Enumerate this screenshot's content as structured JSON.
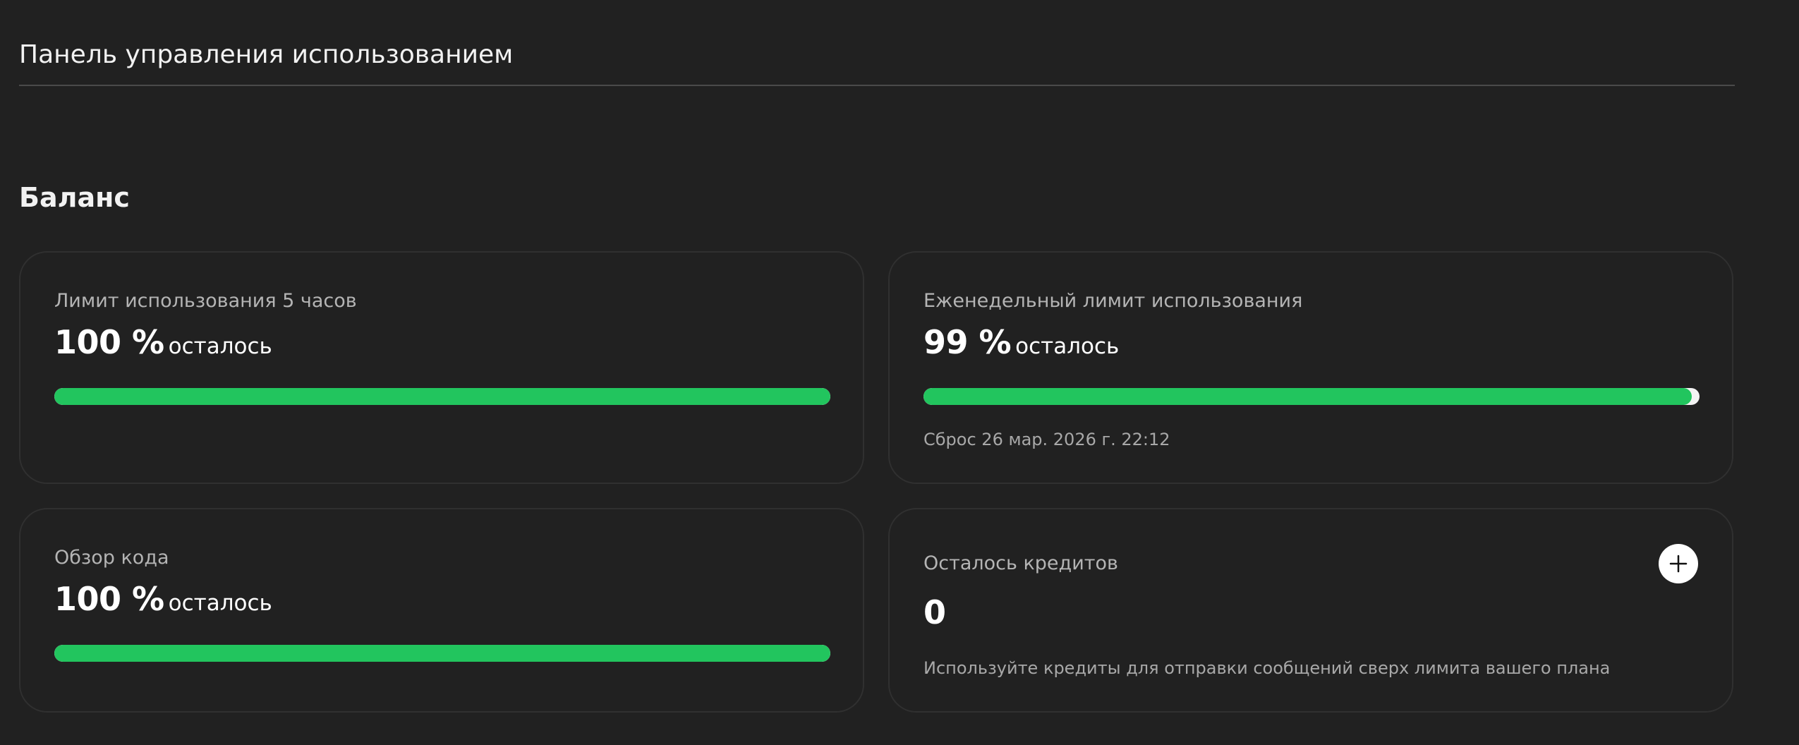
{
  "header": {
    "title": "Панель управления использованием"
  },
  "balance": {
    "title": "Баланс",
    "cards": {
      "five_hour": {
        "label": "Лимит использования 5 часов",
        "value": "100 %",
        "suffix": "осталось",
        "percent_remaining": 100
      },
      "weekly": {
        "label": "Еженедельный лимит использования",
        "value": "99 %",
        "suffix": "осталось",
        "percent_remaining": 99,
        "reset_note": "Сброс 26 мар. 2026 г. 22:12"
      },
      "code_review": {
        "label": "Обзор кода",
        "value": "100 %",
        "suffix": "осталось",
        "percent_remaining": 100
      },
      "credits": {
        "label": "Осталось кредитов",
        "value": "0",
        "note": "Используйте кредиты для отправки сообщений сверх лимита вашего плана",
        "add_icon": "plus-icon"
      }
    }
  },
  "colors": {
    "background": "#212121",
    "card_border": "#303030",
    "progress_fill": "#22c55e",
    "progress_track": "#f4f4f4",
    "label_text": "#b4b4b4"
  }
}
